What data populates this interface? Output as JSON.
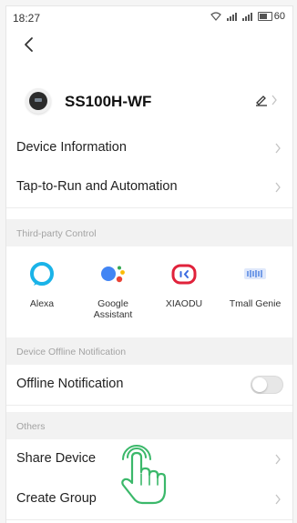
{
  "status_bar": {
    "time": "18:27",
    "battery": "60"
  },
  "device": {
    "name": "SS100H-WF"
  },
  "menu": {
    "device_information": "Device Information",
    "tap_to_run": "Tap-to-Run and Automation"
  },
  "third_party": {
    "section_title": "Third-party Control",
    "items": [
      {
        "label": "Alexa",
        "icon": "alexa-icon"
      },
      {
        "label": "Google Assistant",
        "icon": "google-assistant-icon"
      },
      {
        "label": "XIAODU",
        "icon": "xiaodu-icon"
      },
      {
        "label": "Tmall Genie",
        "icon": "tmall-genie-icon"
      }
    ]
  },
  "offline": {
    "section_title": "Device Offline Notification",
    "label": "Offline Notification",
    "enabled": false
  },
  "others": {
    "section_title": "Others",
    "share_device": "Share Device",
    "create_group": "Create Group"
  },
  "colors": {
    "alexa": "#1ab3e8",
    "xiaodu": "#e0223b",
    "tmall": "#4a7fe0",
    "tap_hand": "#3bb86a"
  }
}
